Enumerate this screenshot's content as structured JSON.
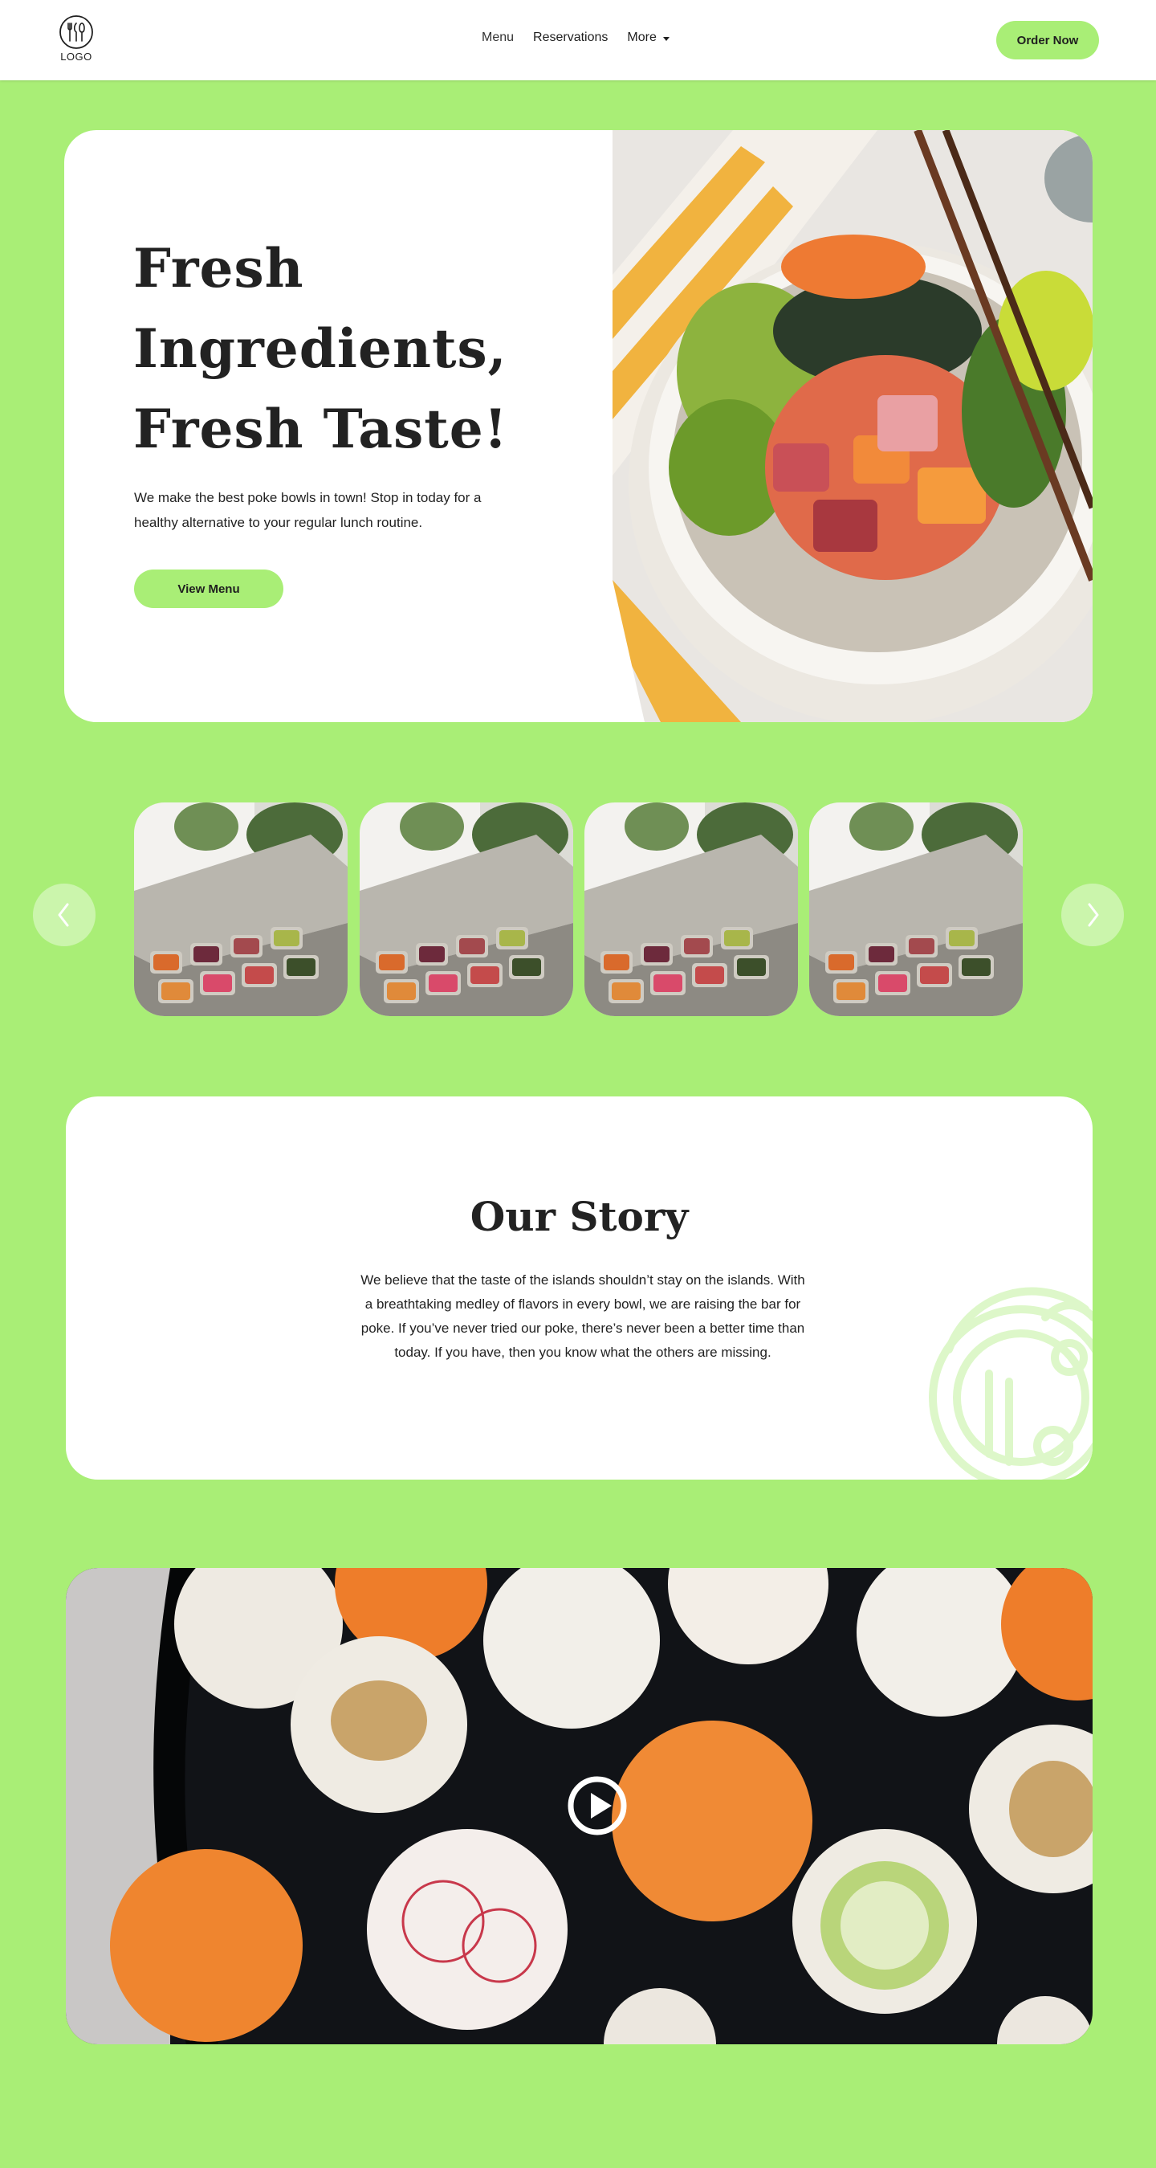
{
  "header": {
    "logo_text": "LOGO",
    "nav": {
      "menu": "Menu",
      "reservations": "Reservations",
      "more": "More"
    },
    "order_button": "Order Now"
  },
  "hero": {
    "title_lines": [
      "Fresh",
      "Ingredients,",
      "Fresh Taste!"
    ],
    "text_lines": [
      "We make the best poke bowls in town! Stop in today for a",
      "healthy alternative to your regular lunch routine."
    ],
    "button": "View Menu"
  },
  "gallery": {
    "item_count": 4,
    "prev_icon": "chevron-left-icon",
    "next_icon": "chevron-right-icon"
  },
  "story": {
    "title": "Our Story",
    "text_lines": [
      "We believe that the taste of the islands shouldn’t stay on the islands. With",
      "a breathtaking medley of flavors in every bowl, we are raising the bar for",
      "poke. If you’ve never tried our poke, there’s never been a better time than",
      "today. If you have, then you know what the others are missing."
    ]
  },
  "video": {
    "play_icon": "play-icon"
  },
  "colors": {
    "brand_green": "#a9ee76",
    "card_white": "#ffffff",
    "text_dark": "#1f1f1f"
  }
}
